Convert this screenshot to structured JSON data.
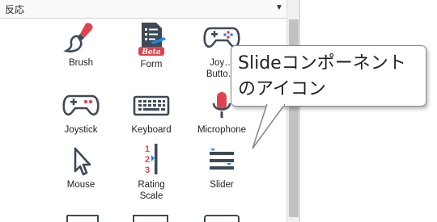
{
  "panel": {
    "category_title": "反応",
    "components": [
      {
        "id": "brush",
        "label": "Brush",
        "icon": "paintbrush-icon"
      },
      {
        "id": "form",
        "label": "Form",
        "icon": "form-icon",
        "badge": "Beta"
      },
      {
        "id": "joystick-button",
        "label": "Joy…\nButto…",
        "icon": "gamepad-icon"
      },
      {
        "id": "joystick",
        "label": "Joystick",
        "icon": "joystick-icon"
      },
      {
        "id": "keyboard",
        "label": "Keyboard",
        "icon": "keyboard-icon"
      },
      {
        "id": "microphone",
        "label": "Microphone",
        "icon": "microphone-icon"
      },
      {
        "id": "mouse",
        "label": "Mouse",
        "icon": "mouse-cursor-icon"
      },
      {
        "id": "rating-scale",
        "label": "Rating\nScale",
        "icon": "rating-scale-icon",
        "numbers": [
          "1",
          "2",
          "3"
        ]
      },
      {
        "id": "slider",
        "label": "Slider",
        "icon": "slider-icon"
      }
    ]
  },
  "callout": {
    "text": "Slideコンポーネント\nのアイコン"
  },
  "colors": {
    "accent_red": "#e0434f",
    "icon_gray": "#3d4a57",
    "accent_blue": "#1e88e5"
  }
}
